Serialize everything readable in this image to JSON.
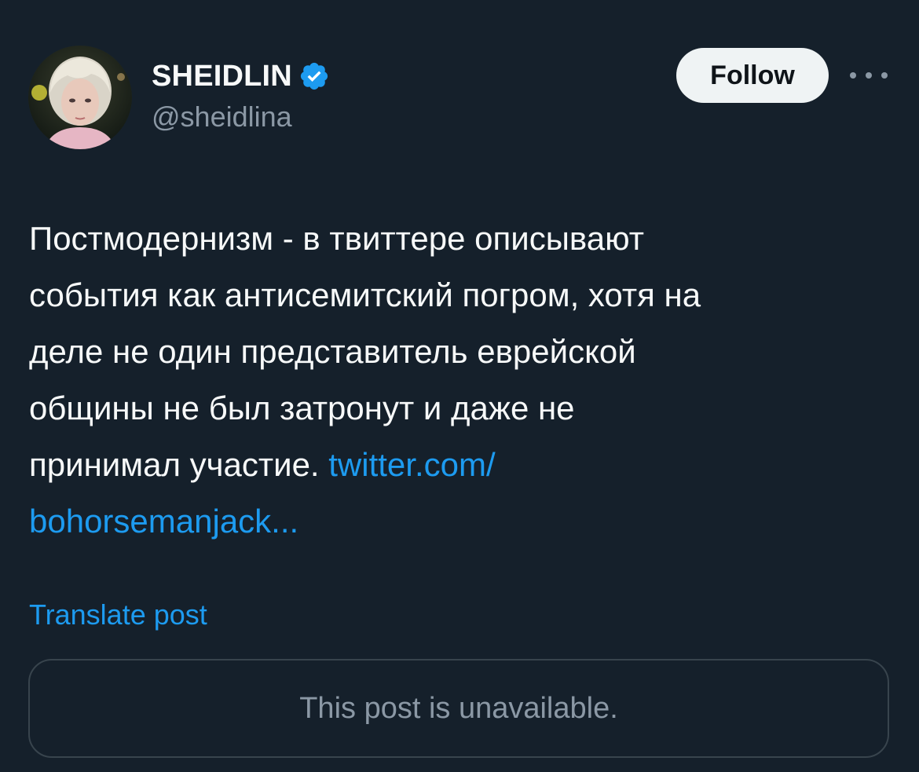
{
  "author": {
    "display_name": "SHEIDLIN",
    "handle": "@sheidlina",
    "verified": true
  },
  "follow_label": "Follow",
  "post": {
    "lines": [
      "Постмодернизм - в твиттере описывают",
      "события как антисемитский погром, хотя на",
      "деле не один представитель еврейской",
      "общины не был затронут и даже не"
    ],
    "last_line_text": "принимал участие. ",
    "link_part1": "twitter.com/",
    "link_part2": "bohorsemanjack..."
  },
  "translate_label": "Translate post",
  "quoted_post": {
    "message": "This post is unavailable."
  },
  "colors": {
    "background": "#15202b",
    "accent": "#1d9bf0",
    "secondary_text": "#8b98a5",
    "border": "#38444d"
  },
  "icons": {
    "verified": "verified-badge-icon",
    "more": "more-options-icon"
  }
}
